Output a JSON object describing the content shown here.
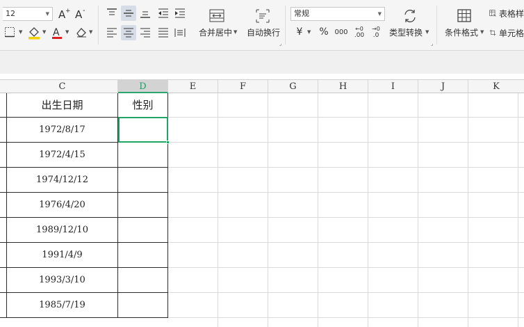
{
  "ribbon": {
    "font_size": "12",
    "number_format": "常规",
    "merge_center_label": "合并居中",
    "wrap_text_label": "自动换行",
    "type_convert_label": "类型转换",
    "cond_format_label": "条件格式",
    "table_style_label": "表格样",
    "cell_label": "单元格",
    "currency_symbol": "¥",
    "percent_symbol": "%",
    "thousands_symbol": "000",
    "inc_decimal": ".0",
    "inc_decimal_top": "←0",
    "dec_decimal": ".00",
    "dec_decimal_top": "→0",
    "accent_color": "#21a366",
    "font_color": "#e02020",
    "highlight_color": "#f5d000"
  },
  "sheet": {
    "columns": [
      "C",
      "D",
      "E",
      "F",
      "G",
      "H",
      "I",
      "J",
      "K"
    ],
    "selected_column": "D",
    "header_row": {
      "c": "出生日期",
      "d": "性别"
    },
    "rows": [
      {
        "c": "1972/8/17",
        "d": ""
      },
      {
        "c": "1972/4/15",
        "d": ""
      },
      {
        "c": "1974/12/12",
        "d": ""
      },
      {
        "c": "1976/4/20",
        "d": ""
      },
      {
        "c": "1989/12/10",
        "d": ""
      },
      {
        "c": "1991/4/9",
        "d": ""
      },
      {
        "c": "1993/3/10",
        "d": ""
      },
      {
        "c": "1985/7/19",
        "d": ""
      }
    ]
  }
}
